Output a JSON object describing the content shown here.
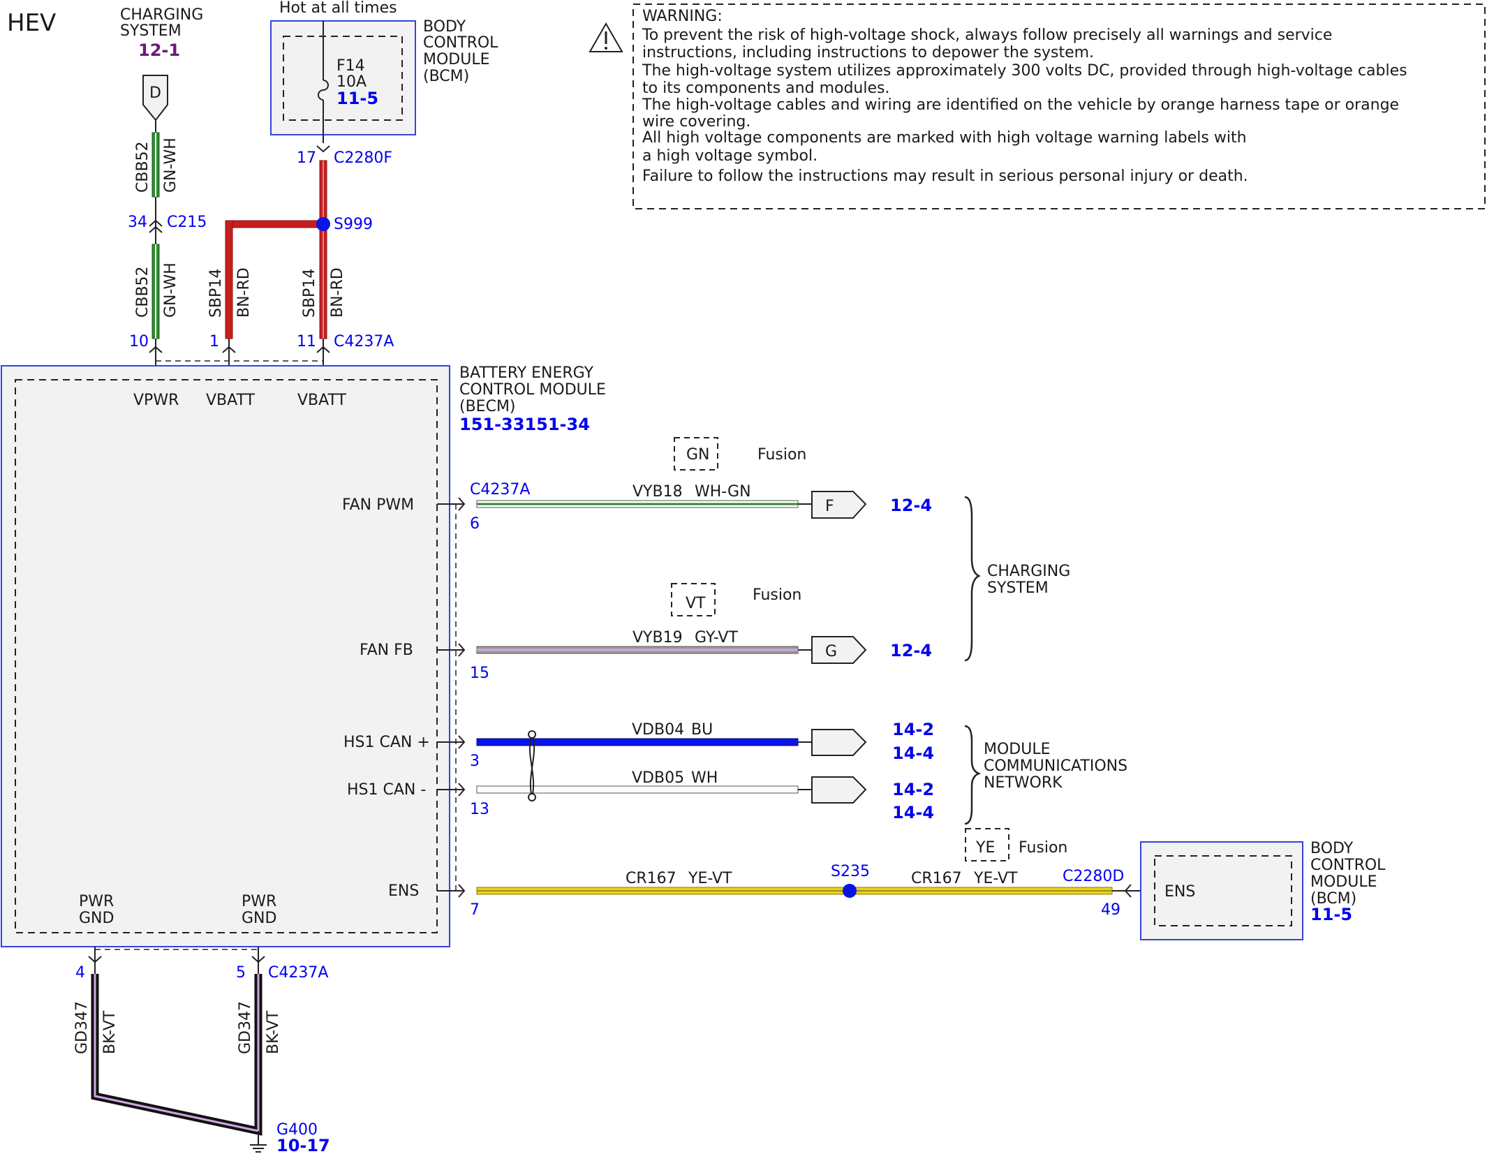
{
  "header": {
    "title": "HEV"
  },
  "warning": {
    "lines": [
      "WARNING:",
      "To prevent the risk of high-voltage shock, always follow precisely all warnings and service",
      "instructions, including instructions to depower the system.",
      "The high-voltage system utilizes approximately 300 volts DC, provided through high-voltage cables",
      "to its components and modules.",
      "The high-voltage cables and wiring are identified on the vehicle by orange harness tape or orange",
      "wire covering.",
      "All high voltage components are marked with high voltage warning labels with",
      "a high voltage symbol.",
      "Failure to follow the instructions may result in serious personal injury or death."
    ]
  },
  "charging_top": {
    "label_lines": [
      "CHARGING",
      "SYSTEM"
    ],
    "ref": "12-1",
    "connector": "D"
  },
  "hot_at_all_times": "Hot at all times",
  "bcm_top": {
    "label_lines": [
      "BODY",
      "CONTROL",
      "MODULE",
      "(BCM)"
    ],
    "fuse_name": "F14",
    "fuse_rating": "10A",
    "fuse_ref": "11-5"
  },
  "c2280f": {
    "pin": "17",
    "name": "C2280F"
  },
  "splice_s999": "S999",
  "c215": {
    "pin": "34",
    "name": "C215"
  },
  "wires_top": {
    "cbb52_upper": {
      "circuit": "CBB52",
      "color": "GN-WH"
    },
    "cbb52_lower": {
      "circuit": "CBB52",
      "color": "GN-WH"
    },
    "sbp14_left": {
      "circuit": "SBP14",
      "color": "BN-RD"
    },
    "sbp14_right": {
      "circuit": "SBP14",
      "color": "BN-RD"
    }
  },
  "c4237a_top": {
    "pin_vpwr": "10",
    "pin_vbatt1": "1",
    "pin_vbatt2": "11",
    "name": "C4237A"
  },
  "becm": {
    "label_lines": [
      "BATTERY ENERGY",
      "CONTROL MODULE",
      "(BECM)"
    ],
    "ref": "151-33151-34",
    "pins": {
      "vpwr": "VPWR",
      "vbatt1": "VBATT",
      "vbatt2": "VBATT",
      "fan_pwm": "FAN PWM",
      "fan_fb": "FAN FB",
      "hs1_can_plus": "HS1 CAN +",
      "hs1_can_minus": "HS1 CAN -",
      "ens": "ENS",
      "pwr_gnd_1": [
        "PWR",
        "GND"
      ],
      "pwr_gnd_2": [
        "PWR",
        "GND"
      ]
    }
  },
  "fan_pwm_circuit": {
    "connector": "C4237A",
    "pin": "6",
    "circuit": "VYB18",
    "color": "WH-GN",
    "option_box": "GN",
    "option_label": "Fusion",
    "dest_connector": "F",
    "dest_ref": "12-4"
  },
  "fan_fb_circuit": {
    "pin": "15",
    "circuit": "VYB19",
    "color": "GY-VT",
    "option_box": "VT",
    "option_label": "Fusion",
    "dest_connector": "G",
    "dest_ref": "12-4"
  },
  "charging_right": {
    "label_lines": [
      "CHARGING",
      "SYSTEM"
    ]
  },
  "can_high": {
    "pin": "3",
    "circuit": "VDB04",
    "color": "BU",
    "refs": [
      "14-2",
      "14-4"
    ]
  },
  "can_low": {
    "pin": "13",
    "circuit": "VDB05",
    "color": "WH",
    "refs": [
      "14-2",
      "14-4"
    ]
  },
  "mcn": {
    "label_lines": [
      "MODULE",
      "COMMUNICATIONS",
      "NETWORK"
    ]
  },
  "ens_circuit": {
    "pin": "7",
    "circuit_left": "CR167",
    "color_left": "YE-VT",
    "splice": "S235",
    "circuit_right": "CR167",
    "color_right": "YE-VT",
    "dest_connector": "C2280D",
    "dest_pin": "49",
    "option_box": "YE",
    "option_label": "Fusion"
  },
  "bcm_right": {
    "label_lines": [
      "BODY",
      "CONTROL",
      "MODULE",
      "(BCM)"
    ],
    "ref": "11-5",
    "pin_label": "ENS"
  },
  "ground": {
    "pin1": "4",
    "pin2": "5",
    "connector": "C4237A",
    "wire1": {
      "circuit": "GD347",
      "color": "BK-VT"
    },
    "wire2": {
      "circuit": "GD347",
      "color": "BK-VT"
    },
    "name": "G400",
    "ref": "10-17"
  },
  "colors": {
    "module_border": "#3344dd",
    "module_fill": "#f2f2f2",
    "ref_blue": "#0000ee",
    "ref_purple": "#6b1a7a",
    "wire_green": "#2e8b2e",
    "wire_red": "#c81e1e",
    "wire_blue": "#0a14e6",
    "wire_yellow": "#e8d21a",
    "wire_violet": "#cfa6e0",
    "wire_black": "#111111"
  }
}
